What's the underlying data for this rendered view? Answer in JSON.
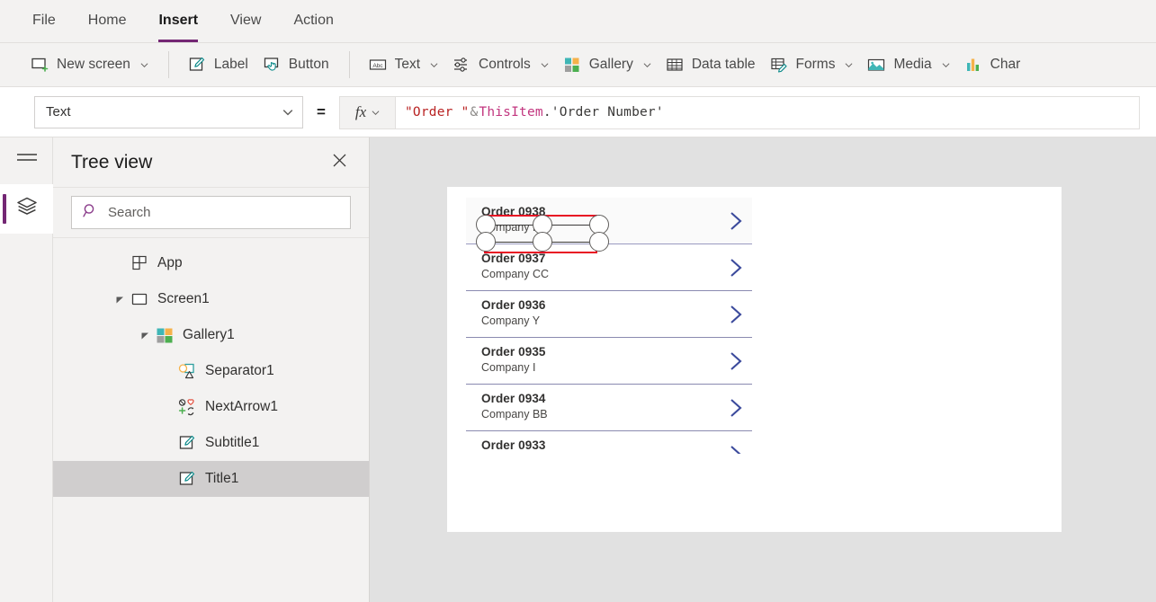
{
  "menu": {
    "tabs": [
      {
        "label": "File",
        "active": false
      },
      {
        "label": "Home",
        "active": false
      },
      {
        "label": "Insert",
        "active": true
      },
      {
        "label": "View",
        "active": false
      },
      {
        "label": "Action",
        "active": false
      }
    ]
  },
  "ribbon": {
    "groups": [
      {
        "buttons": [
          {
            "label": "New screen",
            "icon": "new-screen-icon",
            "has_chevron": true
          }
        ]
      },
      {
        "buttons": [
          {
            "label": "Label",
            "icon": "label-icon",
            "has_chevron": false
          },
          {
            "label": "Button",
            "icon": "button-icon",
            "has_chevron": false
          }
        ]
      },
      {
        "buttons": [
          {
            "label": "Text",
            "icon": "text-abc-icon",
            "has_chevron": true
          },
          {
            "label": "Controls",
            "icon": "controls-sliders-icon",
            "has_chevron": true
          },
          {
            "label": "Gallery",
            "icon": "gallery-grid-icon",
            "has_chevron": true
          },
          {
            "label": "Data table",
            "icon": "data-table-icon",
            "has_chevron": false
          },
          {
            "label": "Forms",
            "icon": "forms-icon",
            "has_chevron": true
          },
          {
            "label": "Media",
            "icon": "media-image-icon",
            "has_chevron": true
          },
          {
            "label": "Char",
            "icon": "charts-icon",
            "has_chevron": false
          }
        ]
      }
    ]
  },
  "property_bar": {
    "selected_property": "Text",
    "equals_sign": "=",
    "fx_label": "fx",
    "formula_tokens": [
      {
        "text": "\"Order \"",
        "type": "string"
      },
      {
        "text": " & ",
        "type": "operator"
      },
      {
        "text": "ThisItem",
        "type": "this-item"
      },
      {
        "text": ".'Order Number'",
        "type": "property"
      }
    ],
    "formula_full": "\"Order \" & ThisItem.'Order Number'"
  },
  "rail": {
    "hamburger": "hamburger-menu-icon",
    "items": [
      {
        "icon": "tree-view-layers-icon",
        "name": "tree-view",
        "active": true
      }
    ]
  },
  "tree_view": {
    "title": "Tree view",
    "close_label": "Close",
    "search": {
      "placeholder": "Search",
      "value": ""
    },
    "items": [
      {
        "label": "App",
        "indent": 0,
        "icon": "app-icon",
        "caret": "none",
        "selected": false
      },
      {
        "label": "Screen1",
        "indent": 0,
        "icon": "screen-icon",
        "caret": "expanded",
        "selected": false
      },
      {
        "label": "Gallery1",
        "indent": 1,
        "icon": "gallery-icon",
        "caret": "expanded",
        "selected": false
      },
      {
        "label": "Separator1",
        "indent": 2,
        "icon": "separator-icon",
        "caret": "none",
        "selected": false
      },
      {
        "label": "NextArrow1",
        "indent": 2,
        "icon": "next-arrow-icon",
        "caret": "none",
        "selected": false
      },
      {
        "label": "Subtitle1",
        "indent": 2,
        "icon": "label-edit-icon",
        "caret": "none",
        "selected": false
      },
      {
        "label": "Title1",
        "indent": 2,
        "icon": "label-edit-icon",
        "caret": "none",
        "selected": true
      }
    ]
  },
  "canvas": {
    "gallery_items": [
      {
        "title": "Order 0938",
        "subtitle": "Company F",
        "selected": true,
        "clipped": false
      },
      {
        "title": "Order 0937",
        "subtitle": "Company CC",
        "selected": false,
        "clipped": false
      },
      {
        "title": "Order 0936",
        "subtitle": "Company Y",
        "selected": false,
        "clipped": false
      },
      {
        "title": "Order 0935",
        "subtitle": "Company I",
        "selected": false,
        "clipped": false
      },
      {
        "title": "Order 0934",
        "subtitle": "Company BB",
        "selected": false,
        "clipped": false
      },
      {
        "title": "Order 0933",
        "subtitle": "",
        "selected": false,
        "clipped": true
      }
    ]
  },
  "colors": {
    "accent_purple": "#742774",
    "selection_red": "#e81123",
    "chevron_blue": "#3b4a9c",
    "ribbon_bg": "#f3f2f1",
    "canvas_bg": "#e1e1e1"
  }
}
